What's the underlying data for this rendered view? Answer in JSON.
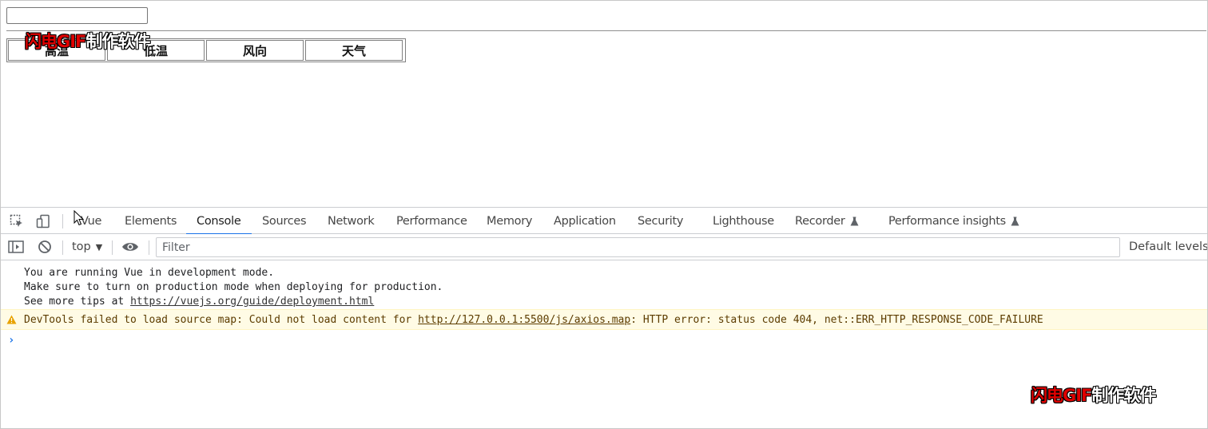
{
  "page": {
    "city_input_value": "",
    "table_headers": [
      "高温",
      "低温",
      "风向",
      "天气"
    ]
  },
  "watermark": {
    "red_part": "闪电GIF",
    "white_part": "制作软件"
  },
  "devtools": {
    "tabs": [
      {
        "label": "Vue",
        "active": false
      },
      {
        "label": "Elements",
        "active": false
      },
      {
        "label": "Console",
        "active": true
      },
      {
        "label": "Sources",
        "active": false
      },
      {
        "label": "Network",
        "active": false
      },
      {
        "label": "Performance",
        "active": false
      },
      {
        "label": "Memory",
        "active": false
      },
      {
        "label": "Application",
        "active": false
      },
      {
        "label": "Security",
        "active": false
      },
      {
        "label": "Lighthouse",
        "active": false
      },
      {
        "label": "Recorder",
        "active": false,
        "experimental": true
      },
      {
        "label": "Performance insights",
        "active": false,
        "experimental": true
      }
    ],
    "toolbar": {
      "context": "top",
      "filter_placeholder": "Filter",
      "filter_value": "",
      "levels_label": "Default levels"
    },
    "console": {
      "info_lines": [
        "You are running Vue in development mode.",
        "Make sure to turn on production mode when deploying for production.",
        "See more tips at "
      ],
      "info_link": "https://vuejs.org/guide/deployment.html",
      "warning": {
        "prefix": "DevTools failed to load source map: Could not load content for ",
        "link": "http://127.0.0.1:5500/js/axios.map",
        "suffix": ": HTTP error: status code 404, net::ERR_HTTP_RESPONSE_CODE_FAILURE"
      },
      "prompt_symbol": "›"
    },
    "colors": {
      "accent": "#1a73e8",
      "warning_bg": "#fffbe5",
      "warning_text": "#5c3c00"
    },
    "icons": [
      "inspect-element-icon",
      "device-toolbar-icon",
      "show-sidebar-icon",
      "clear-console-icon",
      "eye-icon",
      "warning-icon",
      "flask-icon"
    ]
  }
}
